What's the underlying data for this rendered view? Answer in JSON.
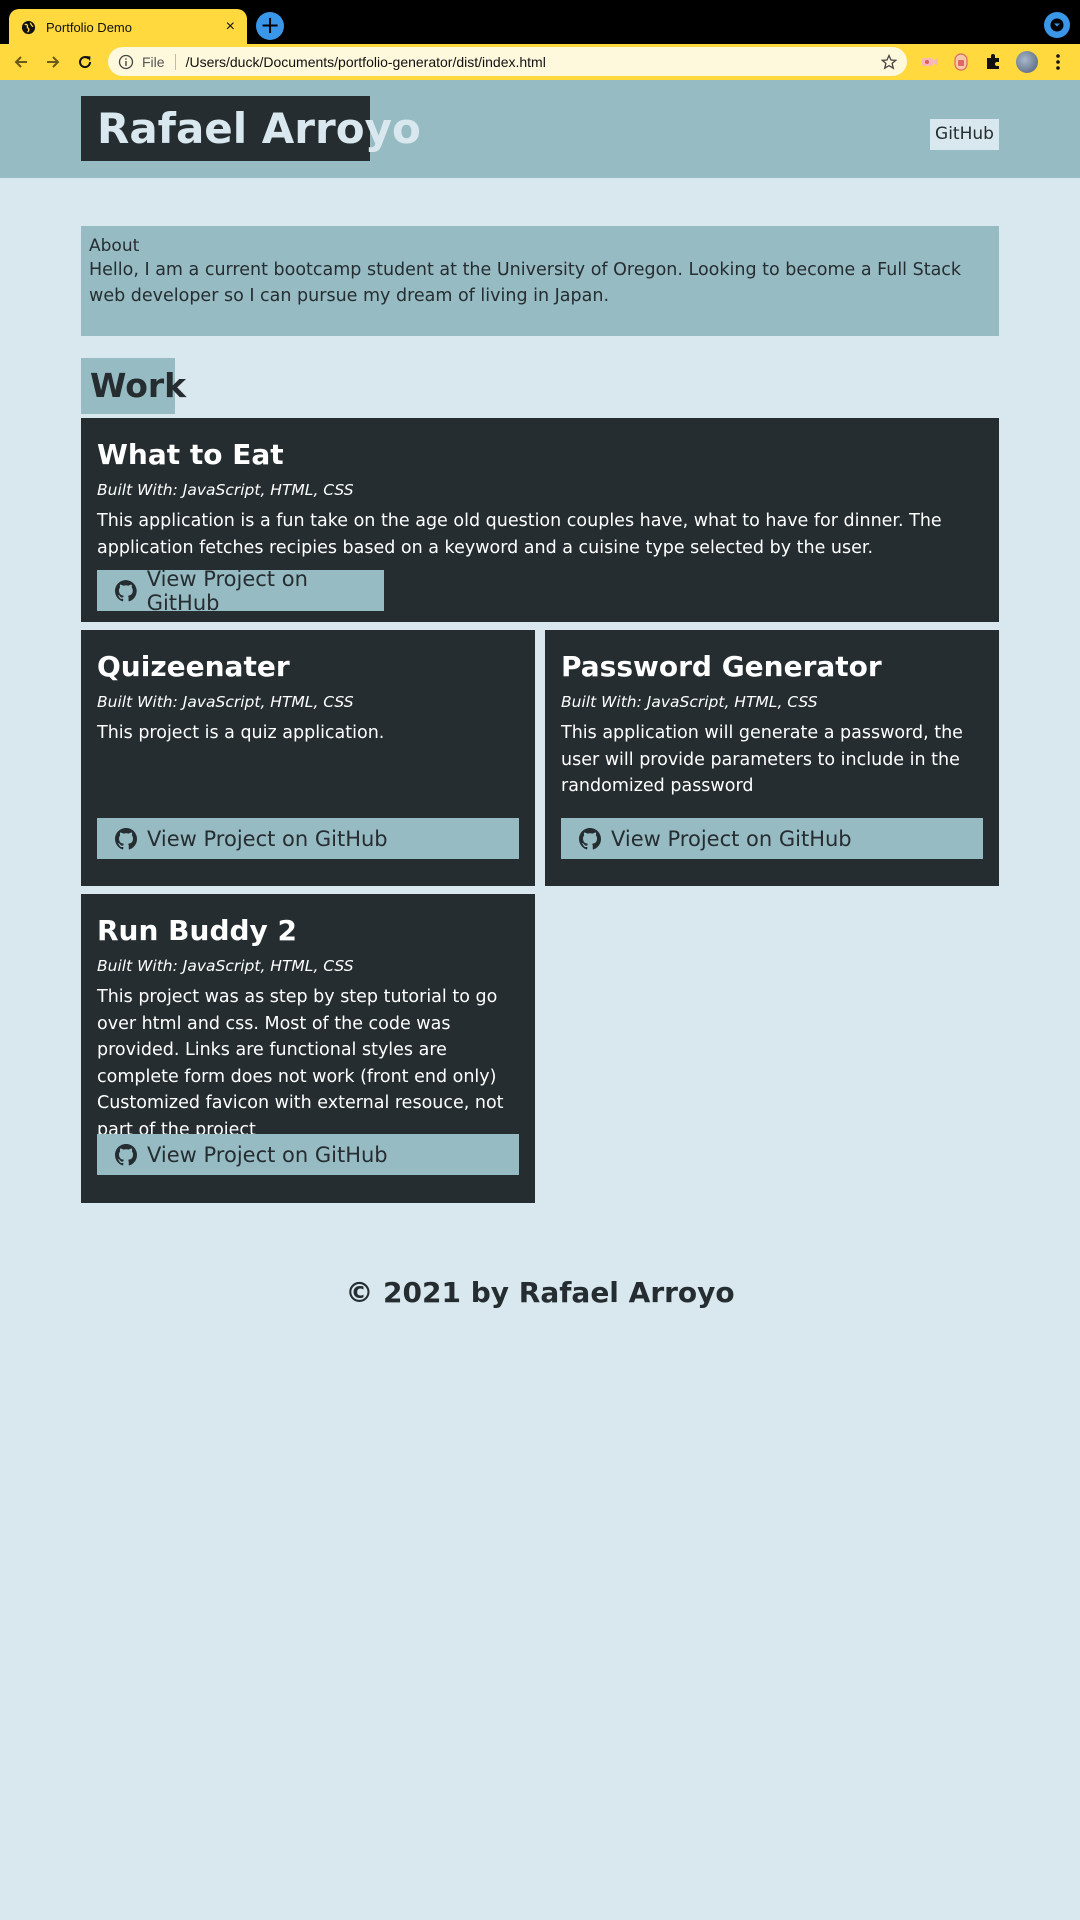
{
  "browser": {
    "tab_title": "Portfolio Demo",
    "tab_close": "×",
    "new_tab": "+",
    "omnibox_scheme": "File",
    "url": "/Users/duck/Documents/portfolio-generator/dist/index.html"
  },
  "header": {
    "name": "Rafael Arroyo",
    "github_link": "GitHub"
  },
  "about": {
    "heading": "About",
    "text": "Hello, I am a current bootcamp student at the University of Oregon. Looking to become a Full Stack web developer so I can pursue my dream of living in Japan."
  },
  "work": {
    "heading": "Work",
    "projects": [
      {
        "title": "What to Eat",
        "built_with": "Built With: JavaScript, HTML, CSS",
        "description": "This application is a fun take on the age old question couples have, what to have for dinner. The application fetches recipies based on a keyword and a cuisine type selected by the user.",
        "button": "View Project on GitHub"
      },
      {
        "title": "Quizeenater",
        "built_with": "Built With: JavaScript, HTML, CSS",
        "description": "This project is a quiz application.",
        "button": "View Project on GitHub"
      },
      {
        "title": "Password Generator",
        "built_with": "Built With: JavaScript, HTML, CSS",
        "description": "This application will generate a password, the user will provide parameters to include in the randomized password",
        "button": "View Project on GitHub"
      },
      {
        "title": "Run Buddy 2",
        "built_with": "Built With: JavaScript, HTML, CSS",
        "description": "This project was as step by step tutorial to go over html and css. Most of the code was provided. Links are functional styles are complete form does not work (front end only) Customized favicon with external resouce, not part of the project",
        "button": "View Project on GitHub"
      }
    ]
  },
  "footer": {
    "text": "© 2021 by Rafael Arroyo"
  },
  "colors": {
    "page_bg": "#d8e8ee",
    "accent": "#97bbc3",
    "dark": "#252d31",
    "chrome": "#ffd93e"
  }
}
